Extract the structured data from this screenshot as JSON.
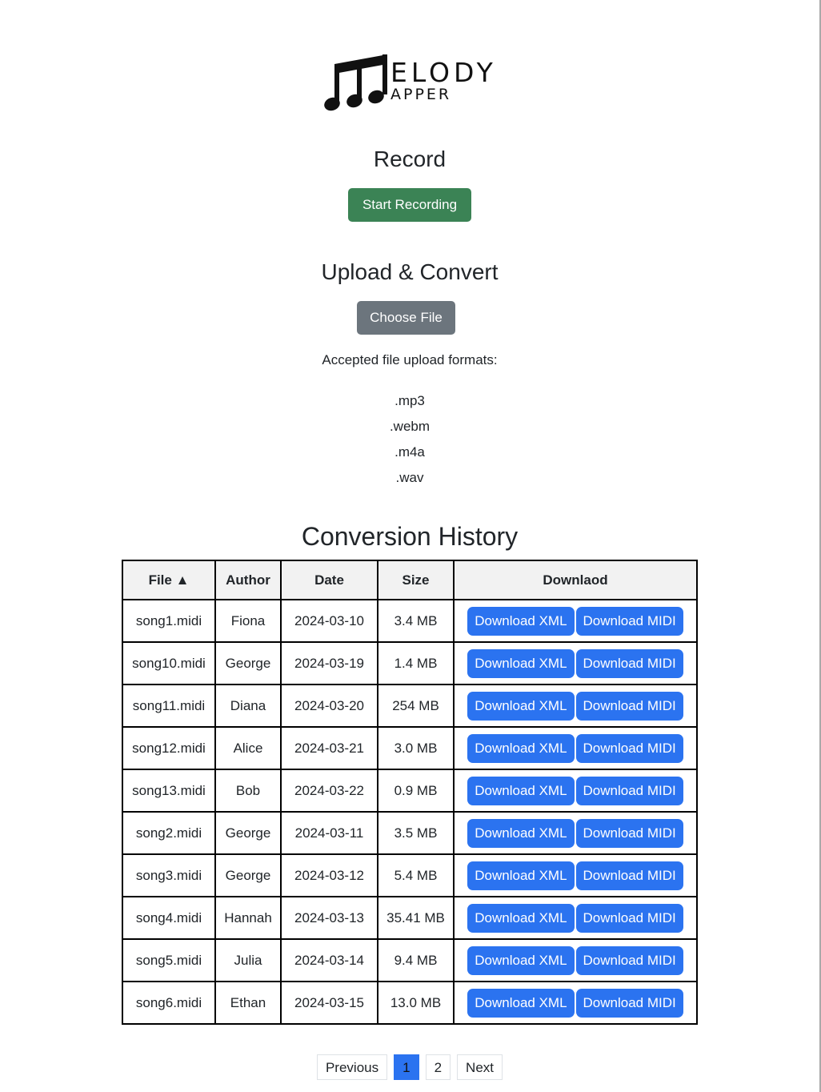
{
  "logo": {
    "word1": "ELODY",
    "word2": "APPER"
  },
  "record": {
    "heading": "Record",
    "button_label": "Start Recording"
  },
  "upload": {
    "heading": "Upload & Convert",
    "button_label": "Choose File",
    "accepted_label": "Accepted file upload formats:",
    "formats": [
      ".mp3",
      ".webm",
      ".m4a",
      ".wav"
    ]
  },
  "history": {
    "heading": "Conversion History",
    "columns": {
      "file": "File",
      "sort_icon": "▲",
      "author": "Author",
      "date": "Date",
      "size": "Size",
      "download": "Downlaod"
    },
    "xml_label": "Download XML",
    "midi_label": "Download MIDI",
    "rows": [
      {
        "file": "song1.midi",
        "author": "Fiona",
        "date": "2024-03-10",
        "size": "3.4 MB"
      },
      {
        "file": "song10.midi",
        "author": "George",
        "date": "2024-03-19",
        "size": "1.4 MB"
      },
      {
        "file": "song11.midi",
        "author": "Diana",
        "date": "2024-03-20",
        "size": "254 MB"
      },
      {
        "file": "song12.midi",
        "author": "Alice",
        "date": "2024-03-21",
        "size": "3.0 MB"
      },
      {
        "file": "song13.midi",
        "author": "Bob",
        "date": "2024-03-22",
        "size": "0.9 MB"
      },
      {
        "file": "song2.midi",
        "author": "George",
        "date": "2024-03-11",
        "size": "3.5 MB"
      },
      {
        "file": "song3.midi",
        "author": "George",
        "date": "2024-03-12",
        "size": "5.4 MB"
      },
      {
        "file": "song4.midi",
        "author": "Hannah",
        "date": "2024-03-13",
        "size": "35.41 MB"
      },
      {
        "file": "song5.midi",
        "author": "Julia",
        "date": "2024-03-14",
        "size": "9.4 MB"
      },
      {
        "file": "song6.midi",
        "author": "Ethan",
        "date": "2024-03-15",
        "size": "13.0 MB"
      }
    ]
  },
  "pagination": {
    "previous": "Previous",
    "pages": [
      "1",
      "2"
    ],
    "current": "1",
    "next": "Next"
  },
  "colors": {
    "record_button": "#3b8355",
    "choose_button": "#6c757d",
    "download_button": "#2b73f0",
    "active_page": "#2b73f0",
    "header_bg": "#f2f2f2"
  }
}
